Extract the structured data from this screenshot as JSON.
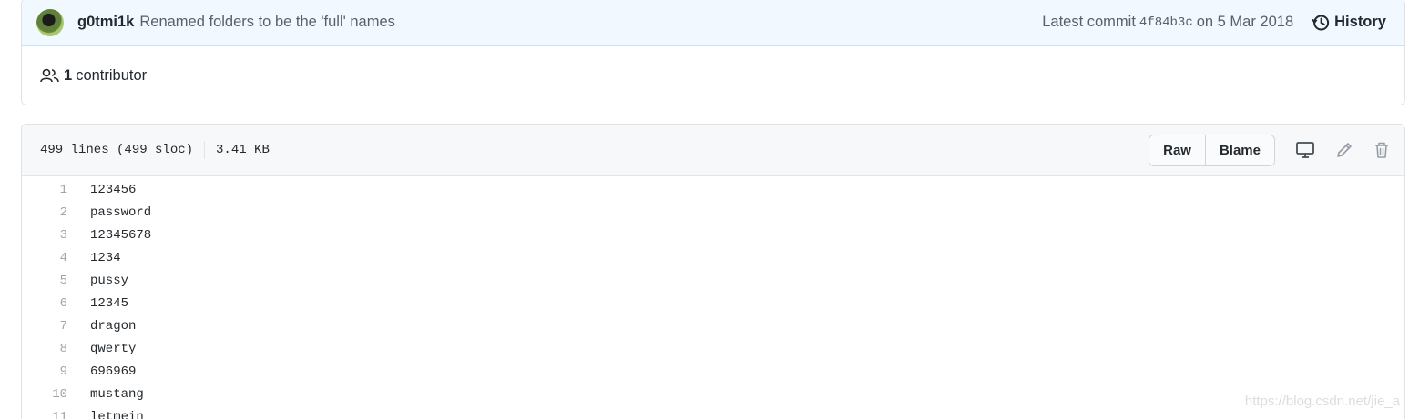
{
  "commit": {
    "author": "g0tmi1k",
    "message": "Renamed folders to be the 'full' names",
    "latest_label": "Latest commit",
    "sha": "4f84b3c",
    "date_text": "on 5 Mar 2018",
    "history_label": "History"
  },
  "contributors": {
    "count": "1",
    "label": "contributor"
  },
  "file": {
    "lines_info": "499 lines (499 sloc)",
    "size": "3.41 KB",
    "raw_label": "Raw",
    "blame_label": "Blame"
  },
  "lines": [
    {
      "n": "1",
      "t": "123456"
    },
    {
      "n": "2",
      "t": "password"
    },
    {
      "n": "3",
      "t": "12345678"
    },
    {
      "n": "4",
      "t": "1234"
    },
    {
      "n": "5",
      "t": "pussy"
    },
    {
      "n": "6",
      "t": "12345"
    },
    {
      "n": "7",
      "t": "dragon"
    },
    {
      "n": "8",
      "t": "qwerty"
    },
    {
      "n": "9",
      "t": "696969"
    },
    {
      "n": "10",
      "t": "mustang"
    },
    {
      "n": "11",
      "t": "letmein"
    }
  ],
  "watermark": "https://blog.csdn.net/jie_a",
  "icons": {
    "history": "history-icon",
    "people": "people-icon",
    "desktop": "desktop-icon",
    "pencil": "pencil-icon",
    "trash": "trash-icon"
  },
  "colors": {
    "commit_bg": "#f1f8ff",
    "header_bg": "#f6f8fa",
    "text": "#24292e",
    "muted": "#586069"
  }
}
